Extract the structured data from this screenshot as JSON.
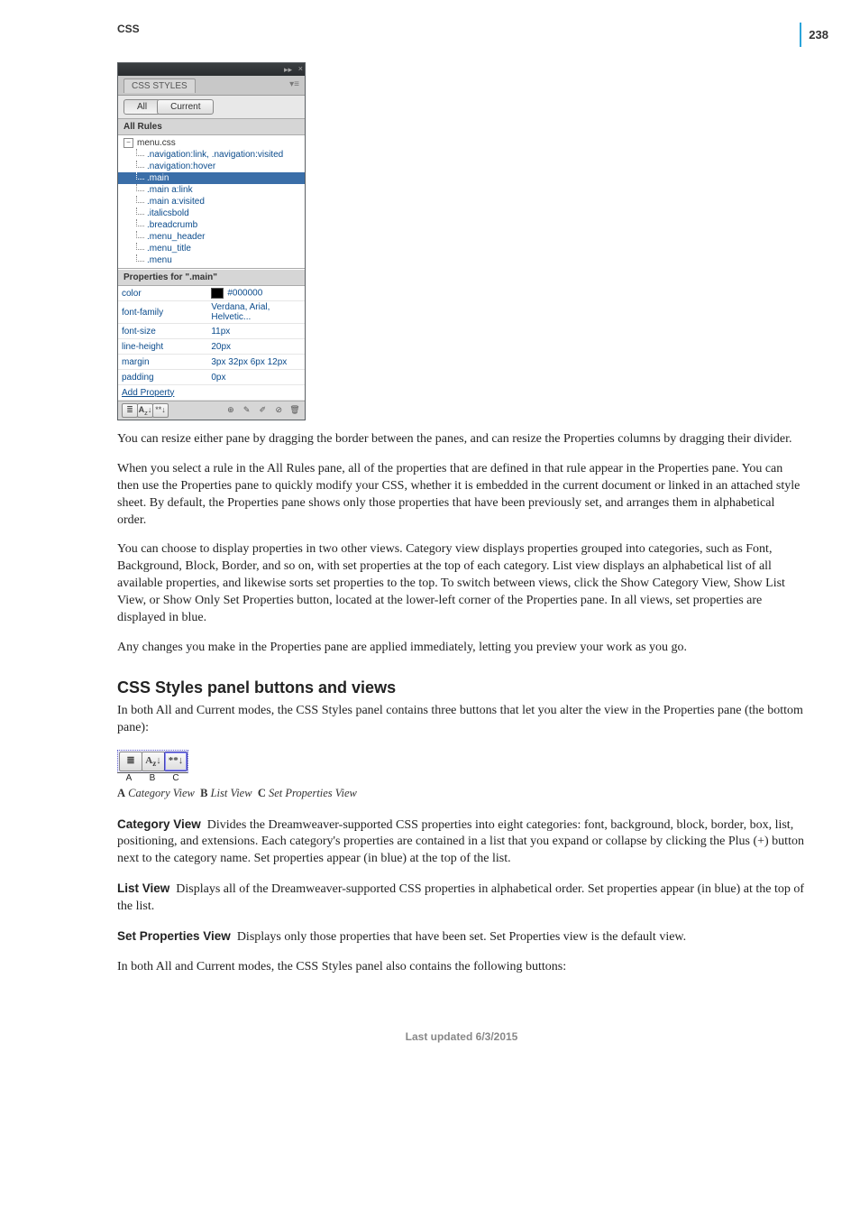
{
  "page_number": "238",
  "running_head": "CSS",
  "panel": {
    "title": "CSS STYLES",
    "mode_all": "All",
    "mode_current": "Current",
    "all_rules_label": "All Rules",
    "tree_root": "menu.css",
    "rules": [
      ".navigation:link, .navigation:visited",
      ".navigation:hover",
      ".main",
      ".main a:link",
      ".main a:visited",
      ".italicsbold",
      ".breadcrumb",
      ".menu_header",
      ".menu_title",
      ".menu"
    ],
    "selected_rule_index": 2,
    "props_for_label": "Properties for \".main\"",
    "props": [
      {
        "name": "color",
        "value": "#000000",
        "swatch": true
      },
      {
        "name": "font-family",
        "value": "Verdana, Arial, Helvetic..."
      },
      {
        "name": "font-size",
        "value": "11px"
      },
      {
        "name": "line-height",
        "value": "20px"
      },
      {
        "name": "margin",
        "value": "3px 32px 6px 12px"
      },
      {
        "name": "padding",
        "value": "0px"
      }
    ],
    "add_property_label": "Add Property",
    "footer_left_icons": [
      "category-view-icon",
      "list-view-icon",
      "set-props-view-icon"
    ],
    "footer_right_icons": [
      "attach-stylesheet-icon",
      "new-rule-icon",
      "edit-rule-icon",
      "disable-icon",
      "trash-icon"
    ]
  },
  "paragraphs": {
    "p1": "You can resize either pane by dragging the border between the panes, and can resize the Properties columns by dragging their divider.",
    "p2": "When you select a rule in the All Rules pane, all of the properties that are defined in that rule appear in the Properties pane. You can then use the Properties pane to quickly modify your CSS, whether it is embedded in the current document or linked in an attached style sheet. By default, the Properties pane shows only those properties that have been previously set, and arranges them in alphabetical order.",
    "p3": "You can choose to display properties in two other views. Category view displays properties grouped into categories, such as Font, Background, Block, Border, and so on, with set properties at the top of each category. List view displays an alphabetical list of all available properties, and likewise sorts set properties to the top. To switch between views, click the Show Category View, Show List View, or Show Only Set Properties button, located at the lower-left corner of the Properties pane. In all views, set properties are displayed in blue.",
    "p4": "Any changes you make in the Properties pane are applied immediately, letting you preview your work as you go.",
    "section_heading": "CSS Styles panel buttons and views",
    "p5": "In both All and Current modes, the CSS Styles panel contains three buttons that let you alter the view in the Properties pane (the bottom pane):",
    "caption_a_label": "A",
    "caption_a_text": "Category View",
    "caption_b_label": "B",
    "caption_b_text": "List View",
    "caption_c_label": "C",
    "caption_c_text": "Set Properties View",
    "def1_term": "Category View",
    "def1_body": "Divides the Dreamweaver-supported CSS properties into eight categories: font, background, block, border, box, list, positioning, and extensions. Each category's properties are contained in a list that you expand or collapse by clicking the Plus (+) button next to the category name. Set properties appear (in blue) at the top of the list.",
    "def2_term": "List View",
    "def2_body": "Displays all of the Dreamweaver-supported CSS properties in alphabetical order. Set properties appear (in blue) at the top of the list.",
    "def3_term": "Set Properties View",
    "def3_body": "Displays only those properties that have been set. Set Properties view is the default view.",
    "p6": "In both All and Current modes, the CSS Styles panel also contains the following buttons:"
  },
  "footer_date": "Last updated 6/3/2015",
  "buttons_figure": {
    "labels": [
      "A",
      "B",
      "C"
    ]
  }
}
